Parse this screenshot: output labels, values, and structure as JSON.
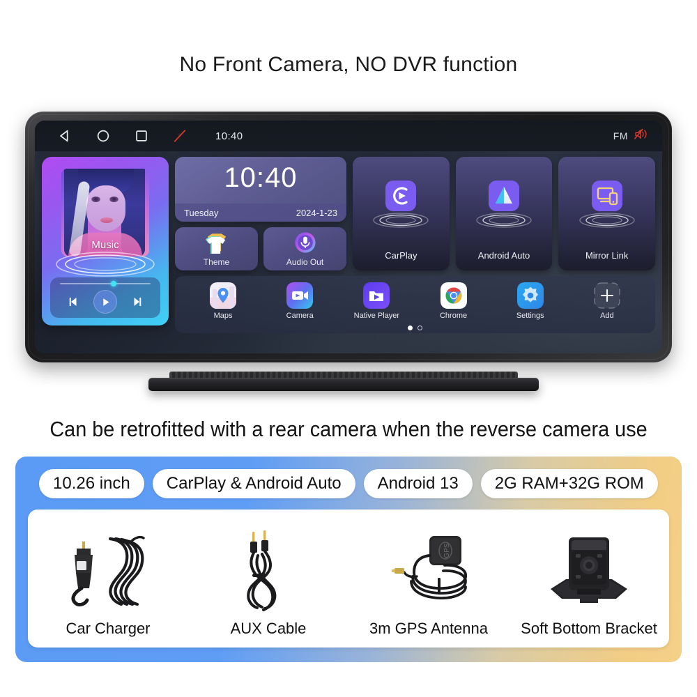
{
  "headline": "No Front Camera, NO DVR function",
  "subtitle": "Can be retrofitted with a rear camera when the reverse camera use",
  "device": {
    "statusbar": {
      "back_icon": "back-triangle-icon",
      "home_icon": "home-circle-icon",
      "recents_icon": "recents-square-icon",
      "camera_disabled_icon": "camera-off-icon",
      "clock": "10:40",
      "fm_label": "FM",
      "mute_icon": "volume-mute-icon"
    },
    "music_widget": {
      "label": "Music",
      "prev_icon": "previous-track-icon",
      "play_icon": "play-icon",
      "next_icon": "next-track-icon",
      "progress_percent": 56
    },
    "clock_widget": {
      "time": "10:40",
      "weekday": "Tuesday",
      "date": "2024-1-23"
    },
    "mini_cards": [
      {
        "label": "Theme",
        "icon": "tshirt-icon"
      },
      {
        "label": "Audio Out",
        "icon": "microphone-icon"
      }
    ],
    "tiles": [
      {
        "label": "CarPlay",
        "icon": "carplay-icon"
      },
      {
        "label": "Android Auto",
        "icon": "android-auto-icon"
      },
      {
        "label": "Mirror Link",
        "icon": "mirror-link-icon"
      }
    ],
    "dock_apps": [
      {
        "label": "Maps",
        "icon": "maps-pin-icon"
      },
      {
        "label": "Camera",
        "icon": "video-camera-icon"
      },
      {
        "label": "Native Player",
        "icon": "media-player-icon"
      },
      {
        "label": "Chrome",
        "icon": "chrome-icon"
      },
      {
        "label": "Settings",
        "icon": "settings-gear-icon"
      },
      {
        "label": "Add",
        "icon": "plus-icon"
      }
    ],
    "page_dots": {
      "total": 2,
      "active": 1
    }
  },
  "spec_pills": [
    "10.26 inch",
    "CarPlay & Android Auto",
    "Android 13",
    "2G RAM+32G ROM"
  ],
  "accessories": [
    {
      "label": "Car Charger",
      "art": "car-charger-photo"
    },
    {
      "label": "AUX Cable",
      "art": "aux-cable-photo"
    },
    {
      "label": "3m GPS Antenna",
      "art": "gps-antenna-photo"
    },
    {
      "label": "Soft Bottom Bracket",
      "art": "bracket-photo"
    }
  ],
  "colors": {
    "card_gradient_start": "#5b9bf5",
    "card_gradient_end": "#f5d089",
    "accent_purple": "#7b5cf0",
    "mute_red": "#e0392c"
  }
}
